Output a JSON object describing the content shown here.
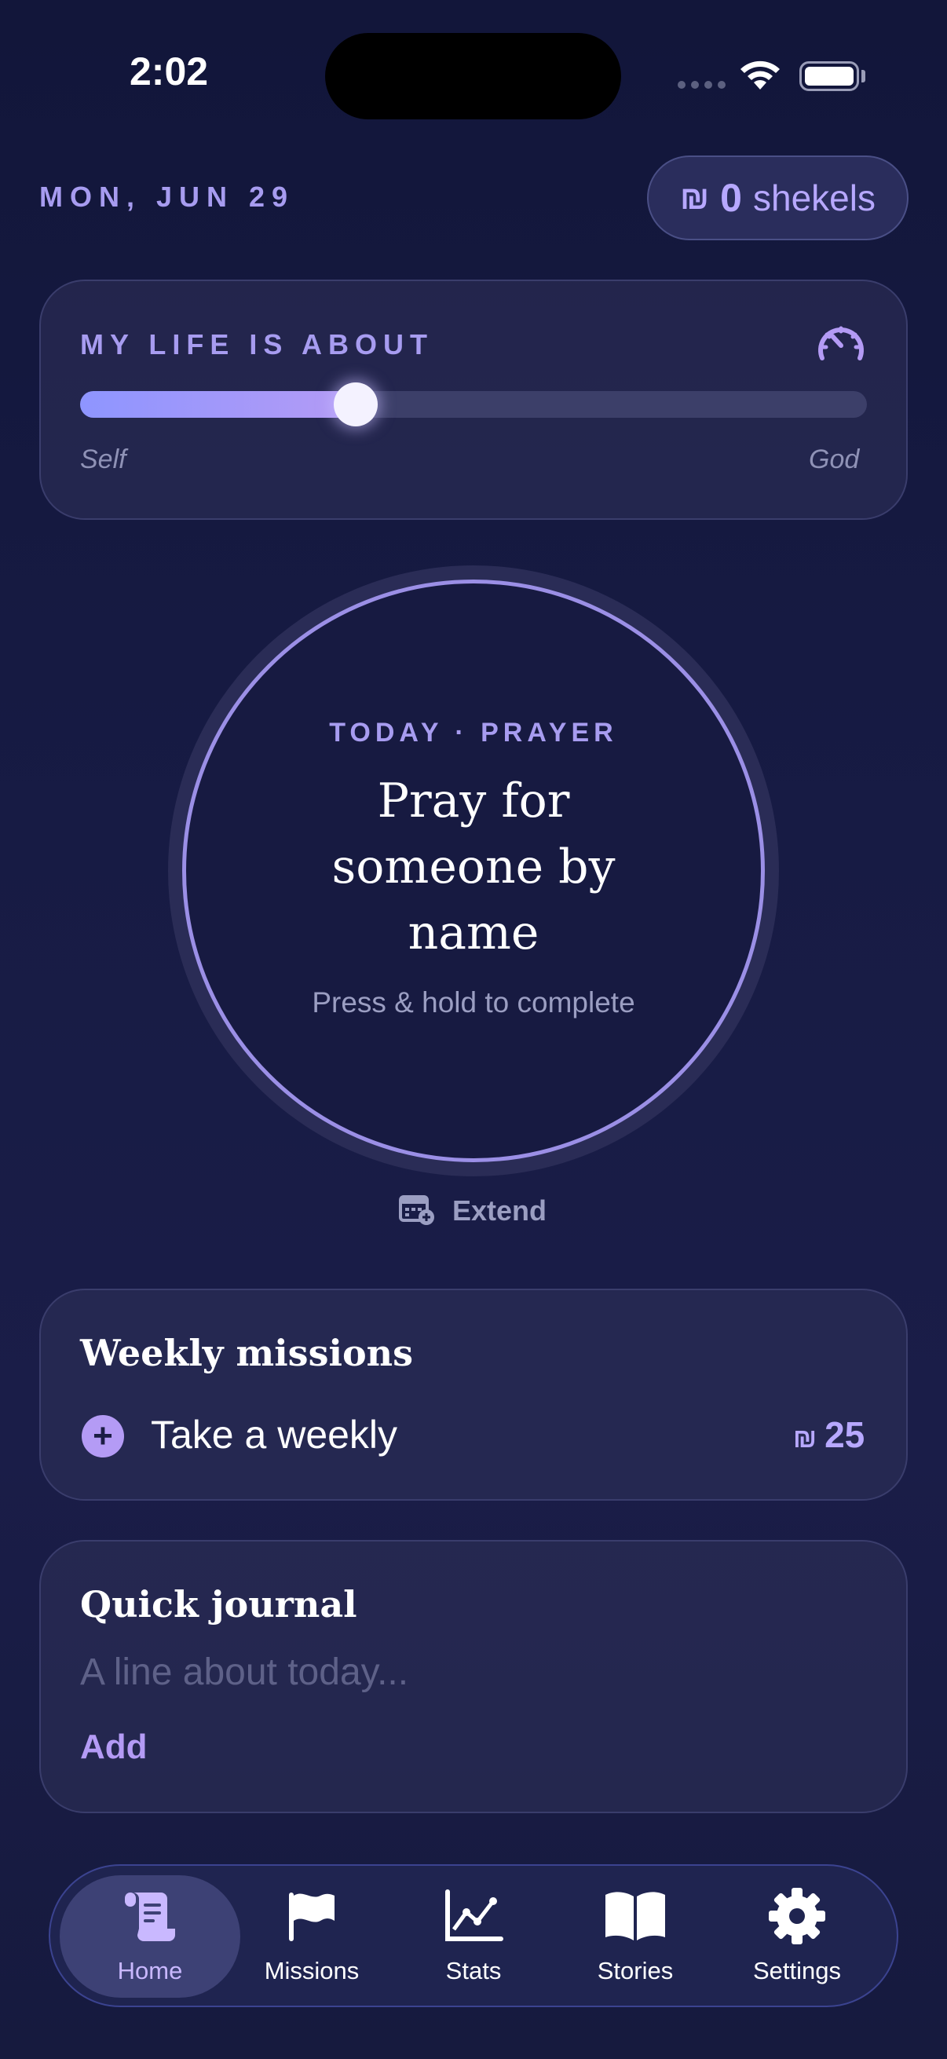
{
  "status_bar": {
    "time": "2:02"
  },
  "header": {
    "date": "MON, JUN 29",
    "shekel_symbol": "₪",
    "shekels_count": "0",
    "shekels_label": "shekels"
  },
  "life_card": {
    "title": "MY LIFE IS ABOUT",
    "left_label": "Self",
    "right_label": "God",
    "slider_value": 0.35,
    "icon": "gauge-icon"
  },
  "today": {
    "label": "TODAY · PRAYER",
    "task": "Pray for someone by name",
    "hint": "Press & hold to complete",
    "extend_label": "Extend"
  },
  "missions": {
    "title": "Weekly missions",
    "items": [
      {
        "text": "Take a weekly",
        "reward_symbol": "₪",
        "reward": "25"
      }
    ]
  },
  "journal": {
    "title": "Quick journal",
    "placeholder": "A line about today...",
    "add_label": "Add"
  },
  "tabs": [
    {
      "label": "Home",
      "icon": "scroll-icon",
      "active": true
    },
    {
      "label": "Missions",
      "icon": "flag-icon",
      "active": false
    },
    {
      "label": "Stats",
      "icon": "chart-icon",
      "active": false
    },
    {
      "label": "Stories",
      "icon": "book-icon",
      "active": false
    },
    {
      "label": "Settings",
      "icon": "gear-icon",
      "active": false
    }
  ],
  "colors": {
    "accent": "#b49bf5",
    "background": "#171a41"
  }
}
